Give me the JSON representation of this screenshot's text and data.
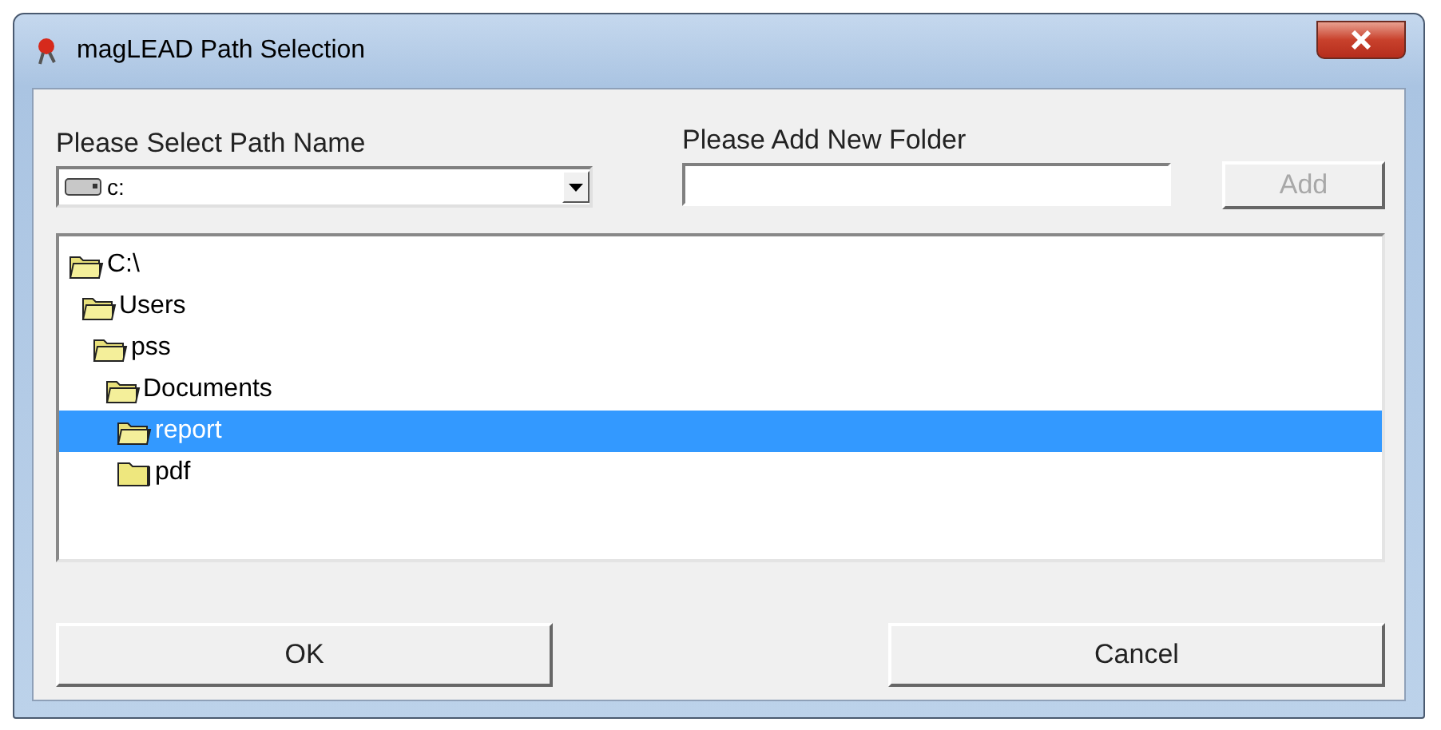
{
  "window": {
    "title": "magLEAD Path Selection"
  },
  "path_select": {
    "label": "Please Select Path Name",
    "value": "c:"
  },
  "new_folder": {
    "label": "Please Add New Folder",
    "add_button": {
      "label": "Add",
      "disabled": true
    }
  },
  "tree": [
    {
      "label": "C:\\",
      "expanded": true,
      "selected": false,
      "children": [
        {
          "label": "Users",
          "expanded": true,
          "selected": false,
          "children": [
            {
              "label": "pss",
              "expanded": true,
              "selected": false,
              "children": [
                {
                  "label": "Documents",
                  "expanded": true,
                  "selected": false,
                  "children": [
                    {
                      "label": "report",
                      "expanded": true,
                      "selected": true
                    },
                    {
                      "label": "pdf",
                      "expanded": false,
                      "selected": false
                    }
                  ]
                }
              ]
            }
          ]
        }
      ]
    }
  ],
  "buttons": [
    "OK",
    "Cancel"
  ]
}
